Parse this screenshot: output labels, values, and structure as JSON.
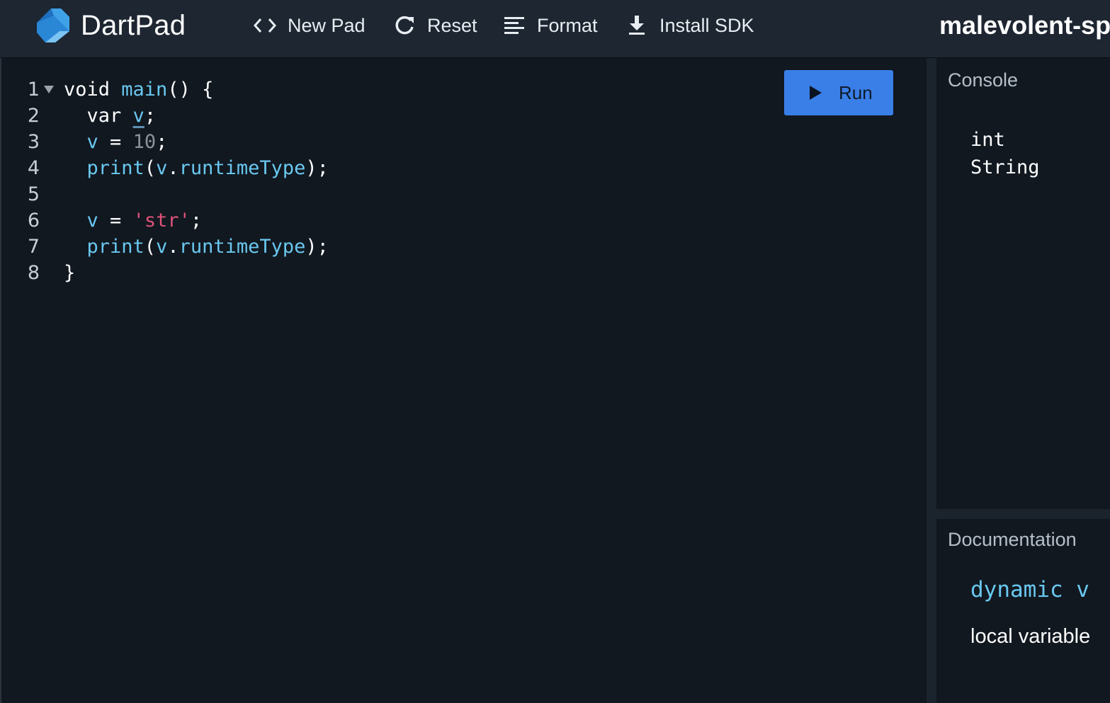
{
  "header": {
    "brand": "DartPad",
    "nav": [
      {
        "label": "New Pad",
        "icon": "code-brackets-icon"
      },
      {
        "label": "Reset",
        "icon": "refresh-icon"
      },
      {
        "label": "Format",
        "icon": "format-align-icon"
      },
      {
        "label": "Install SDK",
        "icon": "download-icon"
      }
    ],
    "pad_name": "malevolent-spa"
  },
  "editor": {
    "run_label": "Run",
    "lines": [
      {
        "number": "1",
        "tokens": [
          {
            "t": "void ",
            "c": "kw"
          },
          {
            "t": "main",
            "c": "fn"
          },
          {
            "t": "() {",
            "c": "plain"
          }
        ]
      },
      {
        "number": "2",
        "tokens": [
          {
            "t": "  var ",
            "c": "kw"
          },
          {
            "t": "v",
            "c": "id"
          },
          {
            "t": ";",
            "c": "plain"
          }
        ]
      },
      {
        "number": "3",
        "tokens": [
          {
            "t": "  v",
            "c": "id"
          },
          {
            "t": " = ",
            "c": "plain"
          },
          {
            "t": "10",
            "c": "num"
          },
          {
            "t": ";",
            "c": "plain"
          }
        ]
      },
      {
        "number": "4",
        "tokens": [
          {
            "t": "  print",
            "c": "fn"
          },
          {
            "t": "(",
            "c": "plain"
          },
          {
            "t": "v",
            "c": "id"
          },
          {
            "t": ".",
            "c": "plain"
          },
          {
            "t": "runtimeType",
            "c": "id"
          },
          {
            "t": ");",
            "c": "plain"
          }
        ]
      },
      {
        "number": "5",
        "tokens": []
      },
      {
        "number": "6",
        "tokens": [
          {
            "t": "  v",
            "c": "id"
          },
          {
            "t": " = ",
            "c": "plain"
          },
          {
            "t": "'str'",
            "c": "str"
          },
          {
            "t": ";",
            "c": "plain"
          }
        ]
      },
      {
        "number": "7",
        "tokens": [
          {
            "t": "  print",
            "c": "fn"
          },
          {
            "t": "(",
            "c": "plain"
          },
          {
            "t": "v",
            "c": "id"
          },
          {
            "t": ".",
            "c": "plain"
          },
          {
            "t": "runtimeType",
            "c": "id"
          },
          {
            "t": ");",
            "c": "plain"
          }
        ]
      },
      {
        "number": "8",
        "tokens": [
          {
            "t": "}",
            "c": "plain"
          }
        ]
      }
    ]
  },
  "console": {
    "title": "Console",
    "output": [
      "int",
      "String"
    ]
  },
  "documentation": {
    "title": "Documentation",
    "signature": "dynamic v",
    "description": "local variable"
  },
  "colors": {
    "accent": "#3a7fe8",
    "identifier": "#6ac8f0",
    "string": "#e0527a",
    "background": "#111820",
    "topbar": "#1d2631"
  }
}
